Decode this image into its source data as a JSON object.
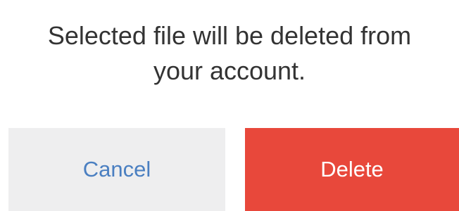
{
  "dialog": {
    "message_line_1": "Selected file will be deleted from",
    "message_line_2": "your account.",
    "cancel_label": "Cancel",
    "delete_label": "Delete"
  },
  "colors": {
    "cancel_background": "#eeeeef",
    "cancel_text": "#4a7fc1",
    "delete_background": "#e8483b",
    "delete_text": "#ffffff",
    "message_text": "#333333"
  }
}
